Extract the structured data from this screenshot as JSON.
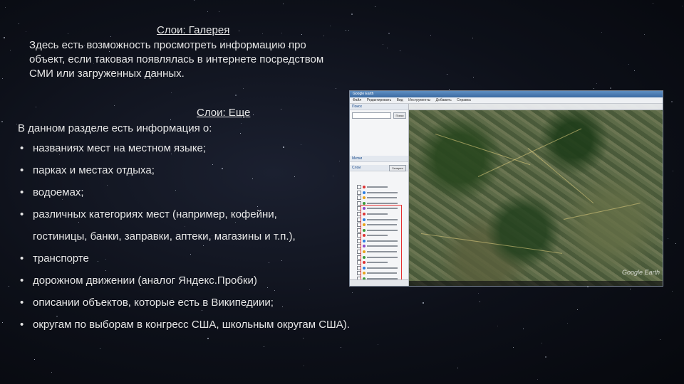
{
  "gallery": {
    "title": "Слои: Галерея",
    "lines": [
      "Здесь есть возможность просмотреть информацию про",
      "объект, если таковая появлялась в интернете посредством",
      "СМИ или загруженных данных."
    ]
  },
  "more": {
    "title": "Слои: Еще",
    "intro": "В данном разделе есть информация о:",
    "bullets": [
      "названиях мест на местном языке;",
      "парках и местах отдыха;",
      "водоемах;",
      "различных категориях мест (например, кофейни,",
      "гостиницы, банки, заправки, аптеки, магазины и т.п.),",
      "транспорте",
      "дорожном движении (аналог Яндекс.Пробки)",
      "описании объектов, которые есть в Википедиии;",
      "округам по выборам в конгресс США, школьным округам США)."
    ],
    "bullet_symbol": "•"
  },
  "screenshot": {
    "window_title": "Google Earth",
    "menu": [
      "Файл",
      "Редактировать",
      "Вид",
      "Инструменты",
      "Добавить",
      "Справка"
    ],
    "search_label": "Поиск",
    "search_button": "Поиск",
    "places_label": "Метки",
    "layers_label": "Слои",
    "gallery_button": "Галерея",
    "map_label": "Google Earth",
    "accent_color": "#e53030"
  }
}
